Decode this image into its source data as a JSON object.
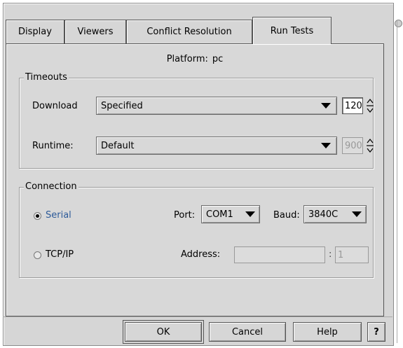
{
  "tabs": [
    "Display",
    "Viewers",
    "Conflict Resolution",
    "Run Tests"
  ],
  "platform": {
    "label": "Platform:",
    "value": "pc"
  },
  "timeouts": {
    "title": "Timeouts",
    "download": {
      "label": "Download",
      "mode": "Specified",
      "value": "120"
    },
    "runtime": {
      "label": "Runtime:",
      "mode": "Default",
      "value": "900"
    }
  },
  "connection": {
    "title": "Connection",
    "serial": {
      "label": "Serial",
      "selected": true
    },
    "tcpip": {
      "label": "TCP/IP",
      "selected": false
    },
    "port": {
      "label": "Port:",
      "value": "COM1"
    },
    "baud": {
      "label": "Baud:",
      "value": "3840C"
    },
    "address": {
      "label": "Address:",
      "value": "",
      "sep": ":",
      "port_value": "1"
    }
  },
  "buttons": {
    "ok": "OK",
    "cancel": "Cancel",
    "help": "Help",
    "question": "?"
  },
  "colors": {
    "panel": "#d8d8d8",
    "selected_radio_text": "#2c5a99"
  }
}
